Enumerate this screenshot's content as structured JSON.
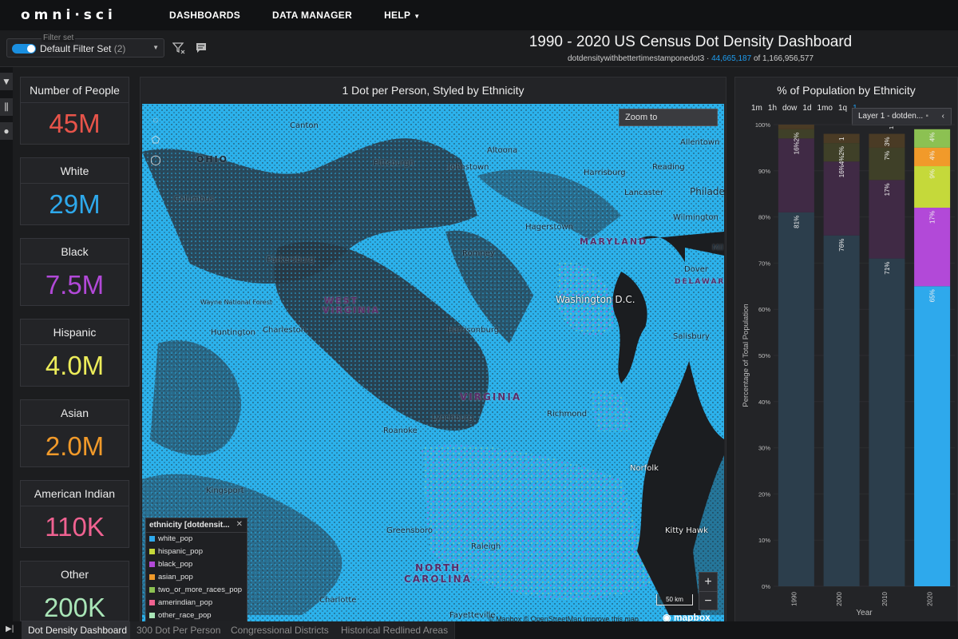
{
  "nav": {
    "logo": "omni·sci",
    "links": [
      "DASHBOARDS",
      "DATA MANAGER",
      "HELP"
    ]
  },
  "filterbar": {
    "filter_set_label": "Filter set",
    "filter_set_value": "Default Filter Set",
    "filter_set_count": "(2)",
    "icons": [
      "filter-clear-icon",
      "comment-icon"
    ]
  },
  "dashboard": {
    "title": "1990 - 2020 US Census Dot Density Dashboard",
    "table_name": "dotdensitywithbettertimestamponedot3",
    "filtered_count": "44,665,187",
    "of_text": "of 1,166,956,577"
  },
  "left_strip_icons": [
    "filter-icon",
    "sliders-icon",
    "palette-icon"
  ],
  "kpis": [
    {
      "label": "Number of People",
      "value": "45M",
      "color": "#e8544a"
    },
    {
      "label": "White",
      "value": "29M",
      "color": "#2ea9ec"
    },
    {
      "label": "Black",
      "value": "7.5M",
      "color": "#b249d8"
    },
    {
      "label": "Hispanic",
      "value": "4.0M",
      "color": "#ecec5a"
    },
    {
      "label": "Asian",
      "value": "2.0M",
      "color": "#f19a2a"
    },
    {
      "label": "American Indian",
      "value": "110K",
      "color": "#f06291"
    },
    {
      "label": "Other",
      "value": "200K",
      "color": "#a9e5b7"
    }
  ],
  "map_panel": {
    "title": "1 Dot per Person, Styled by Ethnicity",
    "zoom_placeholder": "Zoom to",
    "scale_label": "50 km",
    "attribution": "© Mapbox © OpenStreetMap  Improve this map",
    "mapbox_label": "mapbox",
    "labels": [
      {
        "text": "Canton",
        "kind": "city"
      },
      {
        "text": "OHIO",
        "kind": "state"
      },
      {
        "text": "Pittsburgh",
        "kind": "city"
      },
      {
        "text": "Altoona",
        "kind": "city"
      },
      {
        "text": "Johnstown",
        "kind": "city"
      },
      {
        "text": "Allentown",
        "kind": "city"
      },
      {
        "text": "Reading",
        "kind": "city"
      },
      {
        "text": "Harrisburg",
        "kind": "city"
      },
      {
        "text": "Lancaster",
        "kind": "city"
      },
      {
        "text": "Philade",
        "kind": "city"
      },
      {
        "text": "Columbus",
        "kind": "city"
      },
      {
        "text": "Wilmington",
        "kind": "city"
      },
      {
        "text": "Hagerstown",
        "kind": "city"
      },
      {
        "text": "MARYLAND",
        "kind": "state"
      },
      {
        "text": "Parkersburg",
        "kind": "city"
      },
      {
        "text": "Romney",
        "kind": "city"
      },
      {
        "text": "Dover",
        "kind": "city"
      },
      {
        "text": "DELAWARE",
        "kind": "state"
      },
      {
        "text": "Washington D.C.",
        "kind": "city"
      },
      {
        "text": "WEST",
        "kind": "state"
      },
      {
        "text": "VIRGINIA",
        "kind": "state"
      },
      {
        "text": "Wayne National Forest",
        "kind": "city"
      },
      {
        "text": "Huntington",
        "kind": "city"
      },
      {
        "text": "Charleston",
        "kind": "city"
      },
      {
        "text": "Harrisonburg",
        "kind": "city"
      },
      {
        "text": "Salisbury",
        "kind": "city"
      },
      {
        "text": "VIRGINIA",
        "kind": "state"
      },
      {
        "text": "Richmond",
        "kind": "city"
      },
      {
        "text": "Lynchburg",
        "kind": "city"
      },
      {
        "text": "Roanoke",
        "kind": "city"
      },
      {
        "text": "Norfolk",
        "kind": "city"
      },
      {
        "text": "Kingsport",
        "kind": "city"
      },
      {
        "text": "Greensboro",
        "kind": "city"
      },
      {
        "text": "Kitty Hawk",
        "kind": "city"
      },
      {
        "text": "Raleigh",
        "kind": "city"
      },
      {
        "text": "NORTH",
        "kind": "state"
      },
      {
        "text": "CAROLINA",
        "kind": "state"
      },
      {
        "text": "Charlotte",
        "kind": "city"
      },
      {
        "text": "Fayetteville",
        "kind": "city"
      },
      {
        "text": "Mil",
        "kind": "city"
      }
    ],
    "legend": {
      "title": "ethnicity [dotdensit...",
      "items": [
        {
          "label": "white_pop",
          "color": "#2ea9ec"
        },
        {
          "label": "hispanic_pop",
          "color": "#c5d93a"
        },
        {
          "label": "black_pop",
          "color": "#b249d8"
        },
        {
          "label": "asian_pop",
          "color": "#f19a2a"
        },
        {
          "label": "two_or_more_races_pop",
          "color": "#8cc152"
        },
        {
          "label": "amerindian_pop",
          "color": "#f06291"
        },
        {
          "label": "other_race_pop",
          "color": "#a9e5b7"
        }
      ]
    }
  },
  "chart_panel": {
    "title": "% of Population by Ethnicity",
    "time_buttons": [
      "1m",
      "1h",
      "dow",
      "1d",
      "1mo",
      "1q",
      "1"
    ],
    "tooltip": "Layer 1 - dotden..."
  },
  "chart_data": {
    "type": "bar",
    "stacked": true,
    "categories": [
      "1990",
      "2000",
      "2010",
      "2020"
    ],
    "xlabel": "Year",
    "ylabel": "Percentage of Total Population",
    "ylim": [
      0,
      100
    ],
    "y_ticks": [
      "0%",
      "10%",
      "20%",
      "30%",
      "40%",
      "50%",
      "60%",
      "70%",
      "80%",
      "90%",
      "100%"
    ],
    "series": [
      {
        "name": "white_pop",
        "color": "#2c3e4c",
        "values": [
          81,
          76,
          71,
          0
        ]
      },
      {
        "name": "black_pop",
        "color": "#402a45",
        "values": [
          16,
          16,
          17,
          0
        ]
      },
      {
        "name": "hispanic_pop",
        "color": "#3f4028",
        "values": [
          2,
          4,
          7,
          0
        ]
      },
      {
        "name": "asian_pop",
        "color": "#4a3b25",
        "values": [
          1,
          2,
          3,
          0
        ]
      },
      {
        "name": "white_pop_2020",
        "color": "#2ea9ec",
        "values": [
          0,
          0,
          0,
          65
        ]
      },
      {
        "name": "black_pop_2020",
        "color": "#b249d8",
        "values": [
          0,
          0,
          0,
          17
        ]
      },
      {
        "name": "hispanic_pop_2020",
        "color": "#c5d93a",
        "values": [
          0,
          0,
          0,
          9
        ]
      },
      {
        "name": "asian_pop_2020",
        "color": "#f19a2a",
        "values": [
          0,
          0,
          0,
          4
        ]
      },
      {
        "name": "two_or_more_2020",
        "color": "#8cc152",
        "values": [
          0,
          0,
          0,
          4
        ]
      }
    ],
    "bar_labels": [
      {
        "cat": "1990",
        "label": "81%"
      },
      {
        "cat": "1990",
        "label": "16%"
      },
      {
        "cat": "1990",
        "label": "2%"
      },
      {
        "cat": "2000",
        "label": "76%"
      },
      {
        "cat": "2000",
        "label": "16%"
      },
      {
        "cat": "2000",
        "label": "4%2%"
      },
      {
        "cat": "2000",
        "label": "1"
      },
      {
        "cat": "2010",
        "label": "71%"
      },
      {
        "cat": "2010",
        "label": "17%"
      },
      {
        "cat": "2010",
        "label": "7%"
      },
      {
        "cat": "2010",
        "label": "3%"
      },
      {
        "cat": "2010",
        "label": "1"
      },
      {
        "cat": "2020",
        "label": "65%"
      },
      {
        "cat": "2020",
        "label": "17%"
      },
      {
        "cat": "2020",
        "label": "9%"
      },
      {
        "cat": "2020",
        "label": "4%"
      },
      {
        "cat": "2020",
        "label": "4%"
      }
    ]
  },
  "tabs": [
    "Dot Density Dashboard",
    "300 Dot Per Person",
    "Congressional Districts",
    "Historical Redlined Areas"
  ]
}
